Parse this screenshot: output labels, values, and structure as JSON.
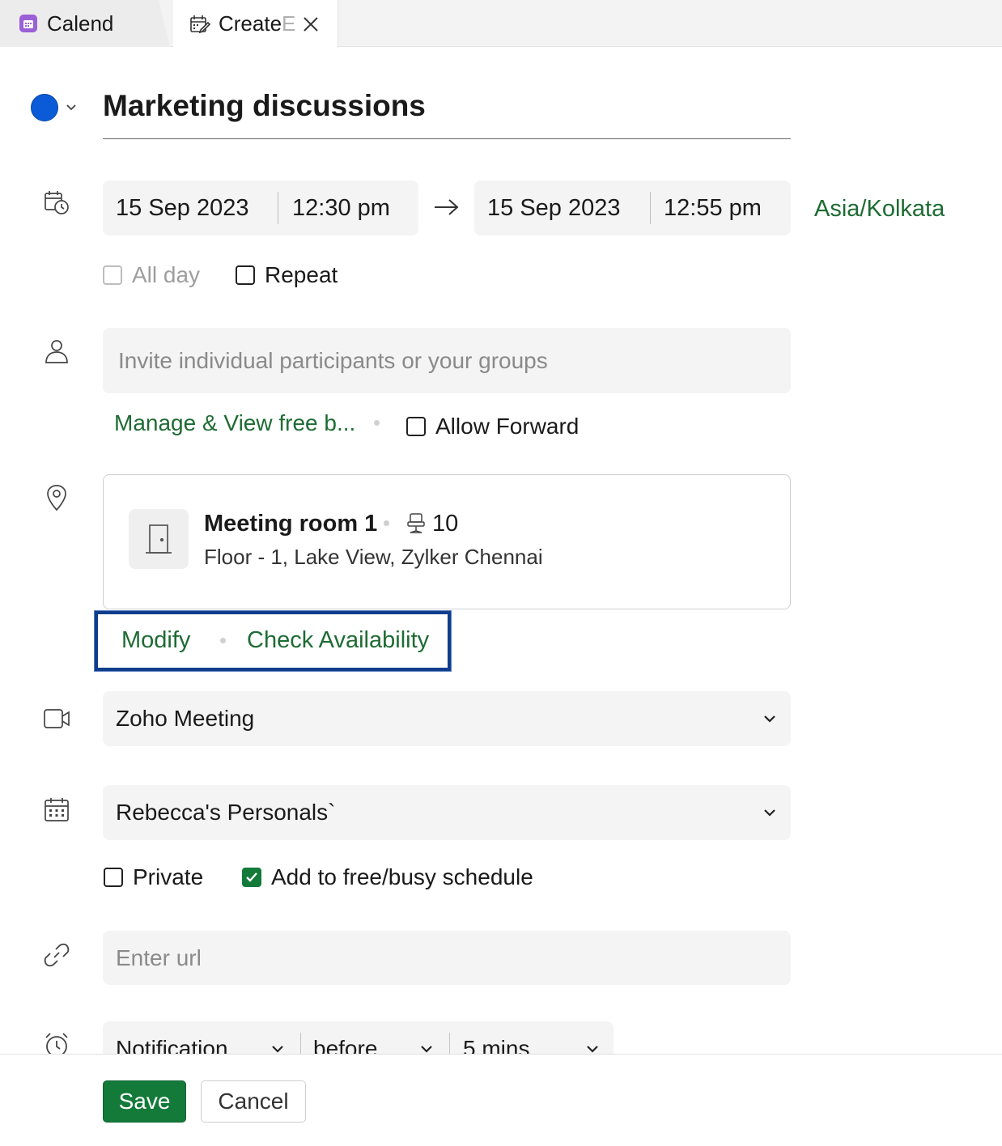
{
  "tabs": [
    {
      "label": "Calend",
      "icon": "calendar-app-icon"
    },
    {
      "label": "Create ",
      "label_faded": "E",
      "icon": "edit-calendar-icon"
    }
  ],
  "event": {
    "color": "#0b5bd8",
    "title": "Marketing discussions"
  },
  "datetime": {
    "start_date": "15 Sep 2023",
    "start_time": "12:30 pm",
    "end_date": "15 Sep 2023",
    "end_time": "12:55 pm",
    "timezone": "Asia/Kolkata",
    "all_day_label": "All day",
    "all_day_checked": false,
    "repeat_label": "Repeat",
    "repeat_checked": false
  },
  "participants": {
    "placeholder": "Invite individual participants or your groups",
    "manage_link": "Manage & View free b...",
    "allow_forward_label": "Allow Forward",
    "allow_forward_checked": false
  },
  "location": {
    "room_name": "Meeting room 1",
    "capacity": "10",
    "address": "Floor - 1, Lake View, Zylker Chennai",
    "modify_link": "Modify",
    "check_availability_link": "Check Availability"
  },
  "conference": {
    "selected": "Zoho Meeting"
  },
  "calendar": {
    "selected": "Rebecca's Personals`",
    "private_label": "Private",
    "private_checked": false,
    "free_busy_label": "Add to free/busy schedule",
    "free_busy_checked": true
  },
  "url": {
    "placeholder": "Enter url"
  },
  "reminder": {
    "type": "Notification",
    "relation": "before",
    "duration": "5 mins"
  },
  "actions": {
    "save_label": "Save",
    "cancel_label": "Cancel"
  },
  "colors": {
    "accent_green": "#137a3a",
    "link_green": "#1e6b33",
    "highlight_blue": "#0e3d8c"
  }
}
